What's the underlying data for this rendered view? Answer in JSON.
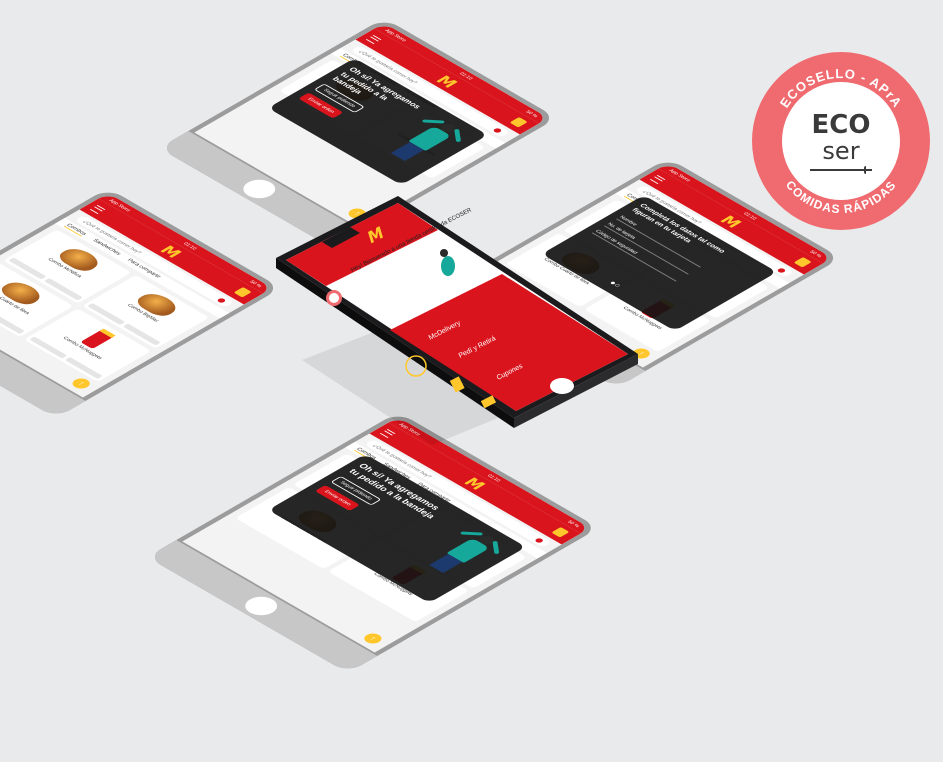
{
  "status": {
    "carrier": "App Store",
    "time": "01:10",
    "battery": "50 %"
  },
  "app": {
    "logo": "M",
    "search_placeholder": "¿Qué te gustaría comer hoy?"
  },
  "tabs": [
    "Combos",
    "Sandwiches",
    "Para compartir"
  ],
  "menu_items": {
    "mcnifica": "Combo McNifica",
    "bigmac": "Combo BigMac",
    "cuarto": "Combo Cuarto de libra",
    "nuggets": "Combo McNuggets"
  },
  "added_overlay": {
    "message": "Oh sí! Ya agregamos tu pedido a la bandeja",
    "keep_ordering": "Seguir pidiendo",
    "send_order": "Enviar orden"
  },
  "card_overlay": {
    "message": "Completá los datos tal como figuran en tu tarjeta",
    "name_label": "Nombre",
    "card_number_label": "No. de tarjeta",
    "security_label": "Código de seguridad"
  },
  "home": {
    "greeting": "Hey! Bienvenido a una tienda certificada ECOSER",
    "service_mcdelivery": "McDelivery",
    "service_pickup": "Pedí y Retirá",
    "service_coupons": "Cupones"
  },
  "badge": {
    "top_text": "ECOSELLO - APrA",
    "eco": "ECO",
    "ser": "ser",
    "bottom_text": "COMIDAS RÁPIDAS"
  },
  "colors": {
    "brand_red": "#d9141c",
    "brand_yellow": "#ffc72c",
    "badge_pink": "#f06b70"
  }
}
